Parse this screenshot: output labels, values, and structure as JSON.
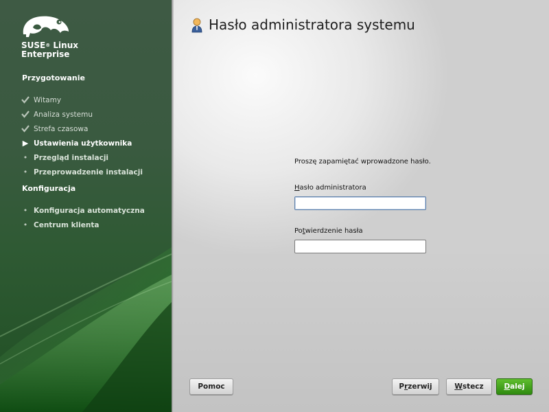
{
  "brand": {
    "line1": "SUSE",
    "reg": "®",
    "line1b": " Linux",
    "line2": "Enterprise"
  },
  "sidebar": {
    "section1": "Przygotowanie",
    "steps1": [
      {
        "label": "Witamy",
        "state": "done"
      },
      {
        "label": "Analiza systemu",
        "state": "done"
      },
      {
        "label": "Strefa czasowa",
        "state": "done"
      },
      {
        "label": "Ustawienia użytkownika",
        "state": "current"
      },
      {
        "label": "Przegląd instalacji",
        "state": "todo"
      },
      {
        "label": "Przeprowadzenie instalacji",
        "state": "todo"
      }
    ],
    "section2": "Konfiguracja",
    "steps2": [
      {
        "label": "Konfiguracja automatyczna",
        "state": "todo"
      },
      {
        "label": "Centrum klienta",
        "state": "todo"
      }
    ]
  },
  "main": {
    "title": "Hasło administratora systemu",
    "info": "Proszę zapamiętać wprowadzone hasło.",
    "password_label_first": "H",
    "password_label_rest": "asło administratora",
    "password_value": "",
    "confirm_label_first": "Po",
    "confirm_label_u": "t",
    "confirm_label_rest": "wierdzenie hasła",
    "confirm_value": ""
  },
  "buttons": {
    "help": "Pomoc",
    "abort_pre": "P",
    "abort_u": "r",
    "abort_post": "zerwij",
    "back_u": "W",
    "back_post": "stecz",
    "next_u": "D",
    "next_post": "alej"
  },
  "icons": {
    "logo": "suse-chameleon-icon",
    "title": "user-admin-icon",
    "done": "check-icon",
    "current": "triangle-right-icon",
    "todo": "bullet-icon"
  },
  "colors": {
    "accent": "#3f9a1c",
    "sidebar": "#2f5a34"
  }
}
